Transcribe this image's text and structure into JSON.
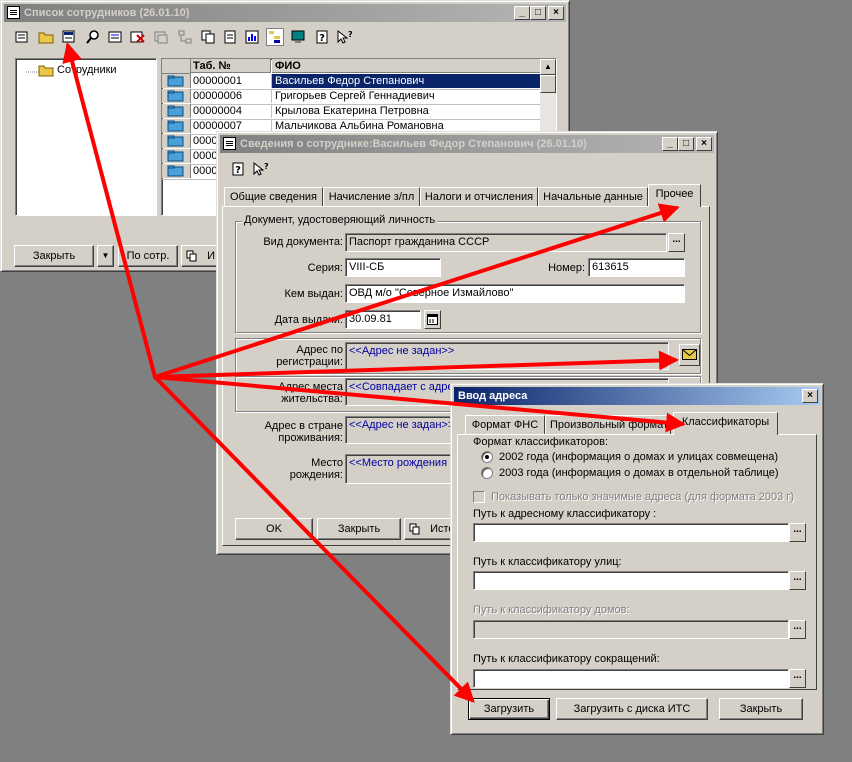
{
  "emp_list": {
    "title": "Список сотрудников (26.01.10)",
    "tree_root": "Сотрудники",
    "columns": [
      "Таб. №",
      "ФИО"
    ],
    "rows": [
      {
        "tab": "00000001",
        "name": "Васильев Федор Степанович",
        "selected": true
      },
      {
        "tab": "00000006",
        "name": "Григорьев Сергей Геннадиевич"
      },
      {
        "tab": "00000004",
        "name": "Крылова Екатерина Петровна"
      },
      {
        "tab": "00000007",
        "name": "Мальчикова Альбина Романовна"
      },
      {
        "tab": "0000",
        "name": ""
      },
      {
        "tab": "0000",
        "name": ""
      },
      {
        "tab": "0000",
        "name": ""
      }
    ],
    "close_btn": "Закрыть",
    "by_emp_btn": "По сотр.",
    "partial_btn": "И"
  },
  "emp_info": {
    "title": "Сведения о сотруднике:Васильев Федор Степанович (26.01.10)",
    "tabs": [
      "Общие сведения",
      "Начисление з/пл",
      "Налоги и отчисления",
      "Начальные данные",
      "Прочее"
    ],
    "selected_tab": 4,
    "doc_group": "Документ, удостоверяющий личность",
    "doc_type_label": "Вид документа:",
    "doc_type": "Паспорт гражданина СССР",
    "series_label": "Серия:",
    "series": "VIII-СБ",
    "number_label": "Номер:",
    "number": "613615",
    "issued_by_label": "Кем выдан:",
    "issued_by": "ОВД м/о \"Северное Измайлово\"",
    "issue_date_label": "Дата выдачи:",
    "issue_date": "30.09.81",
    "reg_addr_label_1": "Адрес по",
    "reg_addr_label_2": "регистрации:",
    "reg_addr": "<<Адрес не задан>>",
    "live_addr_label_1": "Адрес места",
    "live_addr_label_2": "жительства:",
    "live_addr": "<<Совпадает с адре",
    "country_addr_label_1": "Адрес в стране",
    "country_addr_label_2": "проживания:",
    "country_addr": "<<Адрес не задан>>",
    "birth_label_1": "Место",
    "birth_label_2": "рождения:",
    "birth_place": "<<Место рождения",
    "ok_btn": "OK",
    "close_btn": "Закрыть",
    "partial_btn": "Исто"
  },
  "addr_dialog": {
    "title": "Ввод адреса",
    "tabs": [
      "Формат ФНС",
      "Произвольный формат",
      "Классификаторы"
    ],
    "selected_tab": 2,
    "format_label": "Формат классификаторов:",
    "radio_2002": "2002 года (информация о домах и улицах совмещена)",
    "radio_2003": "2003 года (информация о домах в отдельной таблице)",
    "radio_selected": "2002",
    "only_significant": "Показывать только значимые адреса (для формата 2003 г)",
    "path_addr_label": "Путь к  адресному классификатору :",
    "path_addr": "",
    "path_streets_label": "Путь к классификатору улиц:",
    "path_streets": "",
    "path_houses_label": "Путь к классификатору домов:",
    "path_houses": "",
    "path_abbr_label": "Путь к классификатору сокращений:",
    "path_abbr": "",
    "load_btn": "Загрузить",
    "load_its_btn": "Загрузить с диска ИТС",
    "close_btn": "Закрыть"
  },
  "colors": {
    "annotation_arrow": "#ff0000",
    "link_text": "#0000a0",
    "selection": "#0a246a"
  }
}
